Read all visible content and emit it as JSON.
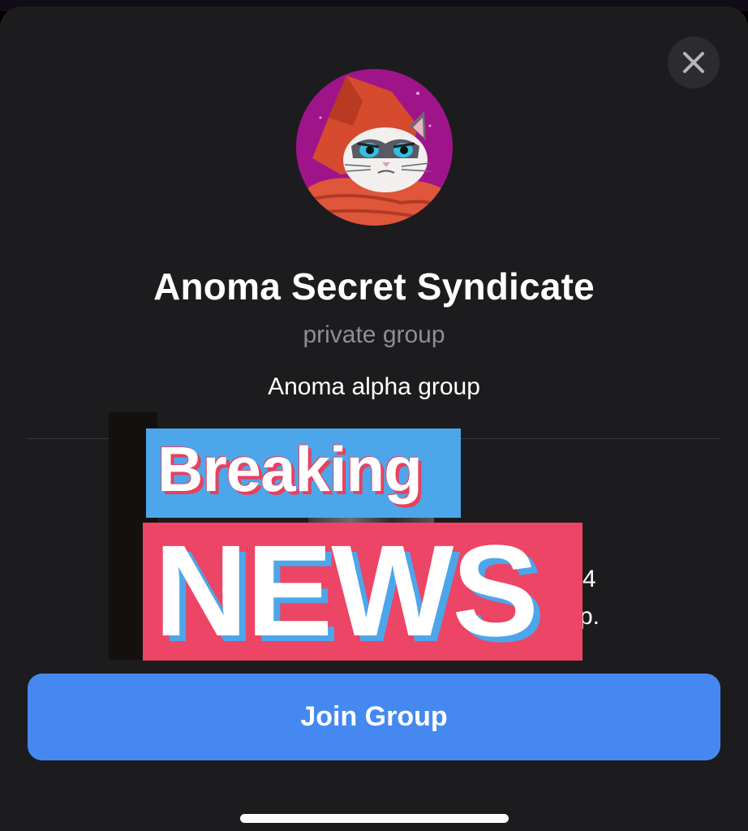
{
  "group": {
    "name": "Anoma Secret Syndicate",
    "type": "private group",
    "description": "Anoma alpha group"
  },
  "obscured_text": {
    "line1_tail": "4",
    "line2_tail": "p."
  },
  "sticker": {
    "top_word": "Breaking",
    "bottom_word": "NEWS"
  },
  "actions": {
    "join_label": "Join Group",
    "close_icon": "close-icon"
  },
  "colors": {
    "sheet_background": "#1c1c1e",
    "join_button": "#4589f0",
    "breaking_box": "#4da6ea",
    "news_box": "#ec4565"
  }
}
